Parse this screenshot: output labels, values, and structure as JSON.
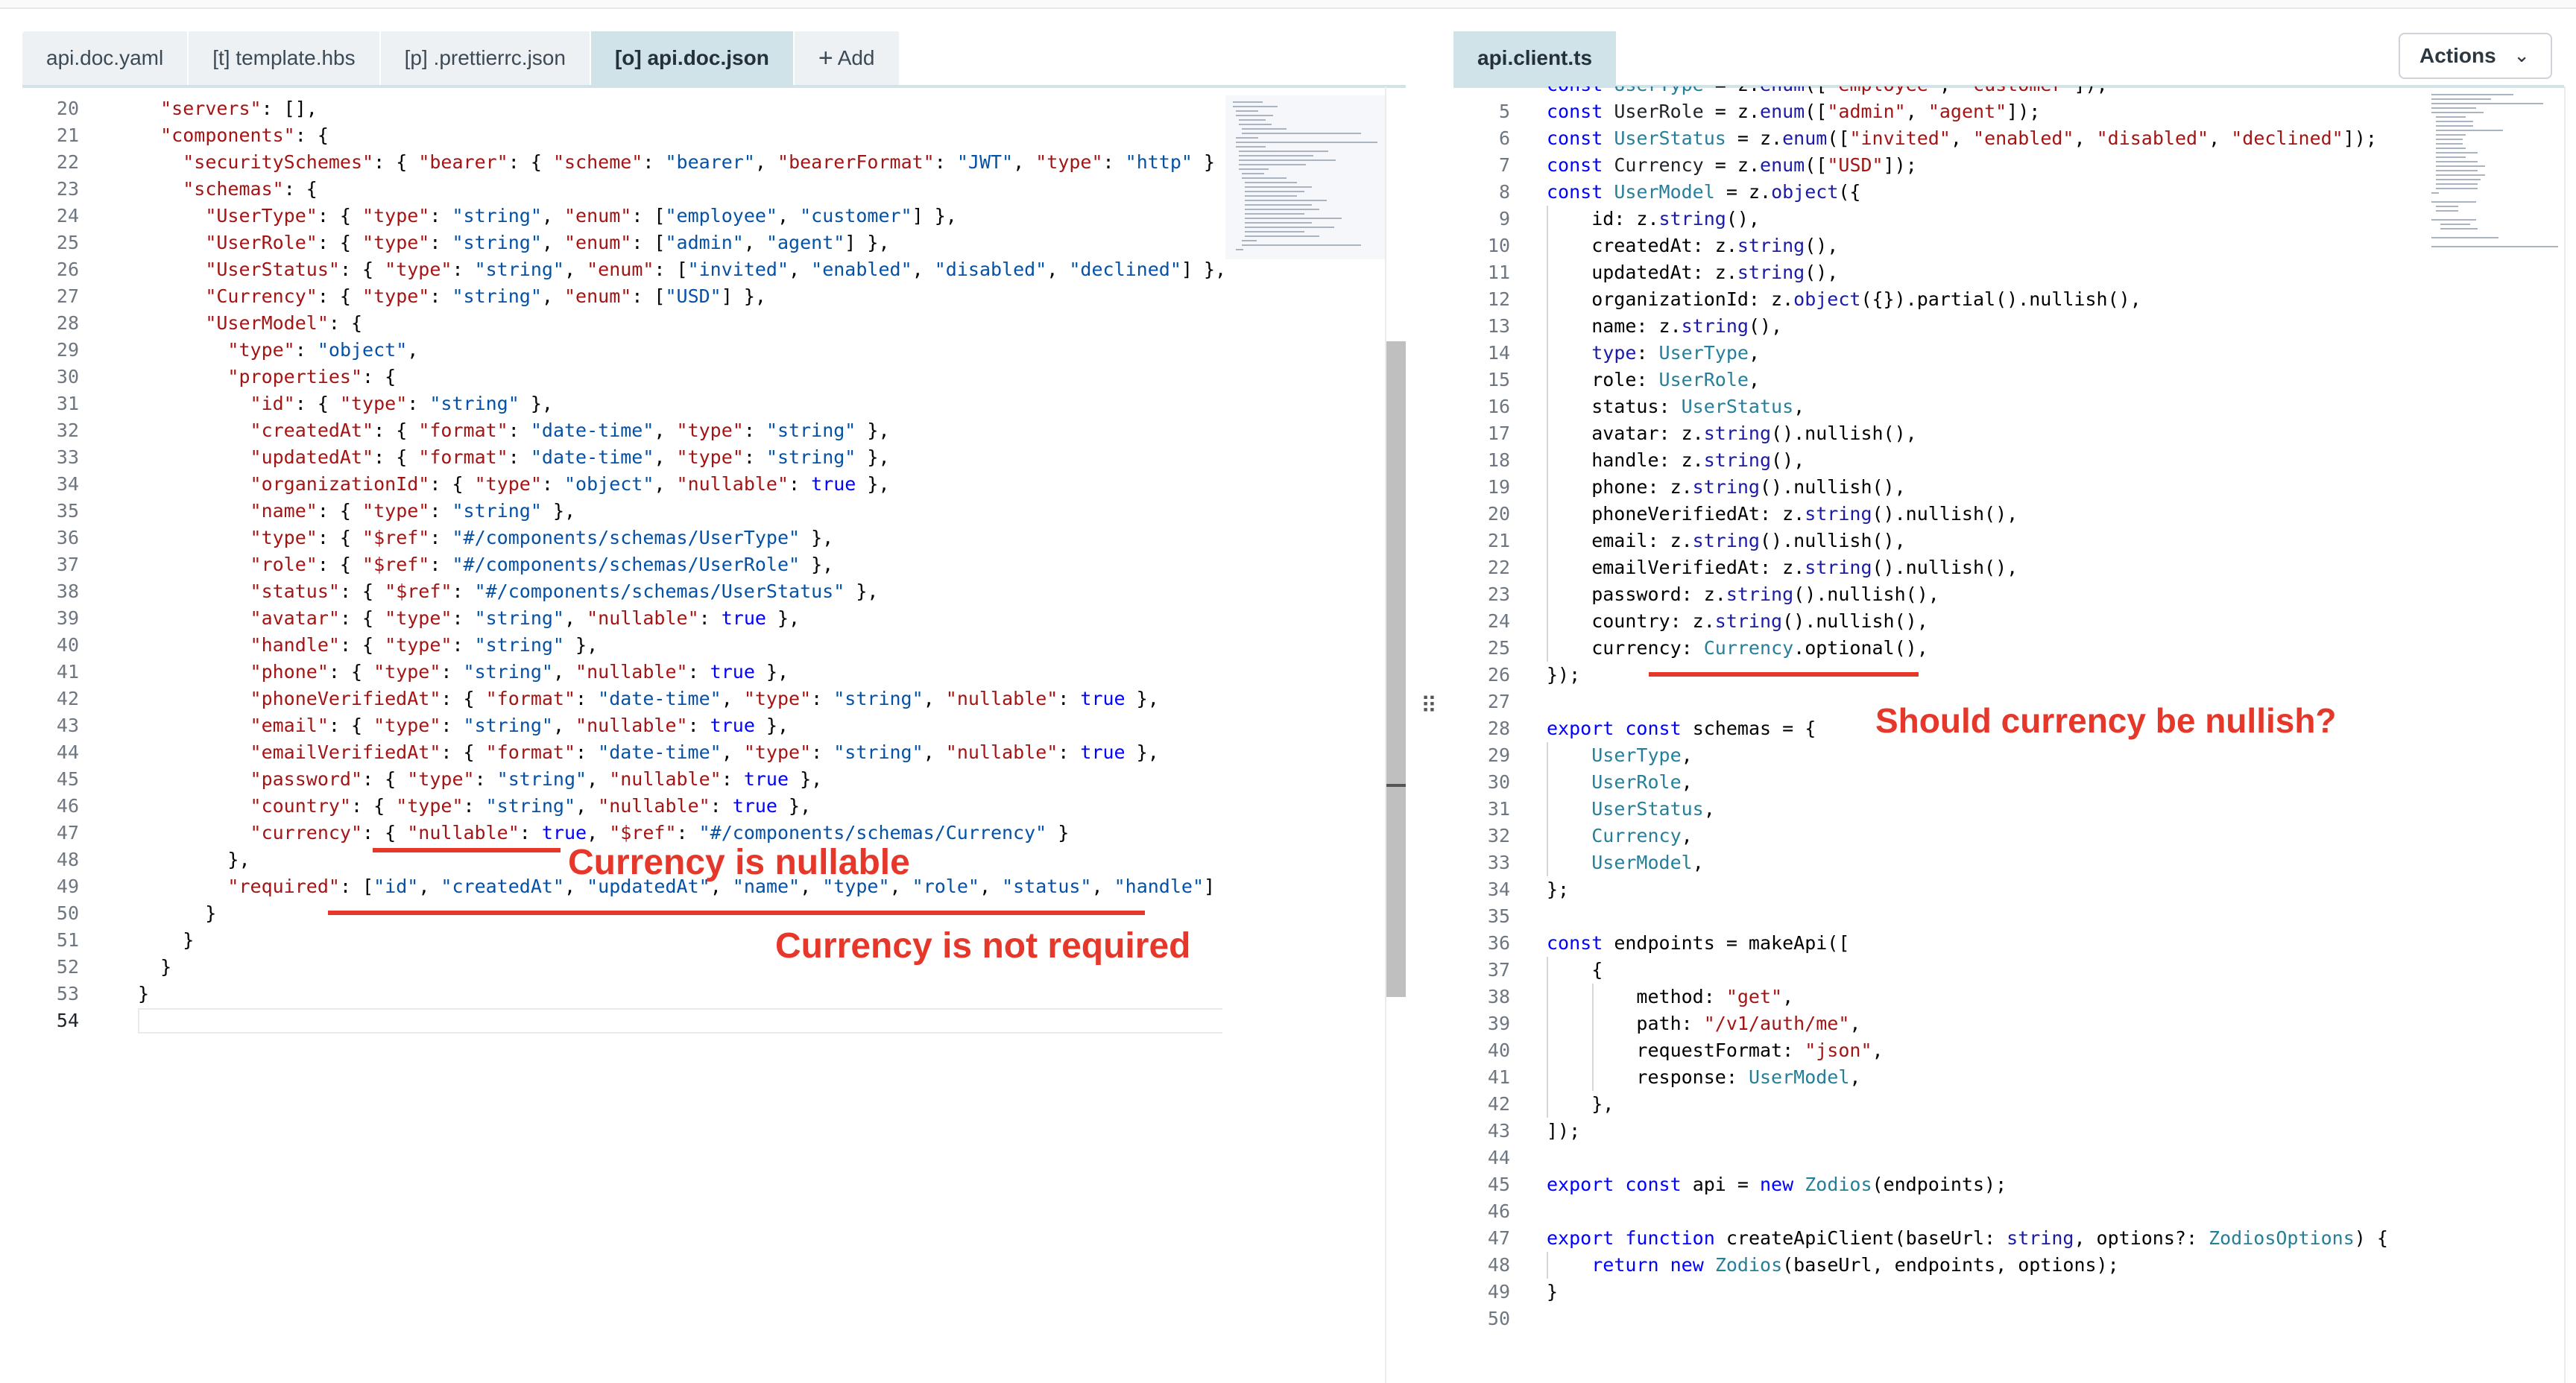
{
  "left_tabs": [
    {
      "label": "api.doc.yaml"
    },
    {
      "label": "[t] template.hbs"
    },
    {
      "label": "[p] .prettierrc.json"
    },
    {
      "label": "[o] api.doc.json",
      "active": true
    }
  ],
  "add_tab_label": "Add",
  "right_tabs": [
    {
      "label": "api.client.ts",
      "active": true
    }
  ],
  "actions_label": "Actions",
  "annotations": {
    "nullable": "Currency is nullable",
    "not_required": "Currency is not required",
    "question": "Should  currency be nullish?"
  },
  "left_editor": {
    "line_numbers": [
      "20",
      "21",
      "22",
      "23",
      "24",
      "25",
      "26",
      "27",
      "28",
      "29",
      "30",
      "31",
      "32",
      "33",
      "34",
      "35",
      "36",
      "37",
      "38",
      "39",
      "40",
      "41",
      "42",
      "43",
      "44",
      "45",
      "46",
      "47",
      "48",
      "49",
      "50",
      "51",
      "52",
      "53",
      "54"
    ],
    "current_line": "54"
  },
  "right_editor": {
    "line_numbers": [
      "5",
      "6",
      "7",
      "8",
      "9",
      "10",
      "11",
      "12",
      "13",
      "14",
      "15",
      "16",
      "17",
      "18",
      "19",
      "20",
      "21",
      "22",
      "23",
      "24",
      "25",
      "26",
      "27",
      "28",
      "29",
      "30",
      "31",
      "32",
      "33",
      "34",
      "35",
      "36",
      "37",
      "38",
      "39",
      "40",
      "41",
      "42",
      "43",
      "44",
      "45",
      "46",
      "47",
      "48",
      "49",
      "50"
    ]
  },
  "colors": {
    "annotation": "#e5382b",
    "active_tab": "#cfe3e8"
  }
}
